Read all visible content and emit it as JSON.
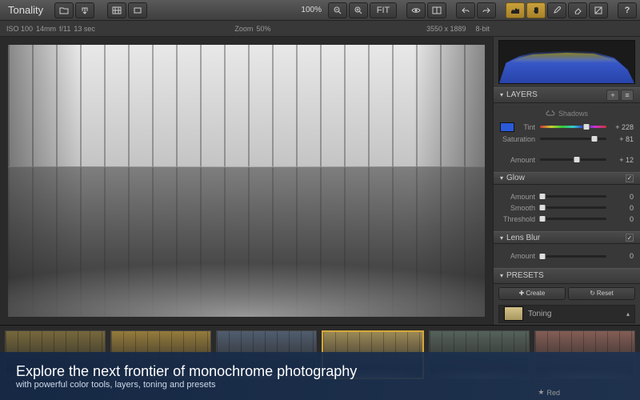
{
  "app": {
    "name": "Tonality"
  },
  "toolbar": {
    "zoom_pct": "100%",
    "fit_label": "FIT"
  },
  "info": {
    "iso": "ISO 100",
    "focal": "14mm",
    "aperture": "f/11",
    "shutter": "13  sec",
    "zoom_label": "Zoom",
    "zoom_value": "50%",
    "dimensions": "3550 x 1889",
    "bitdepth": "8-bit"
  },
  "layers": {
    "title": "LAYERS",
    "shadows_label": "Shadows",
    "tint_label": "Tint",
    "tint_value": "+ 228",
    "sat_label": "Saturation",
    "sat_value": "+ 81",
    "amount_label": "Amount",
    "amount_value": "+ 12",
    "tint_color": "#2a5ad8"
  },
  "glow": {
    "title": "Glow",
    "amount_label": "Amount",
    "amount_value": "0",
    "smooth_label": "Smooth",
    "smooth_value": "0",
    "threshold_label": "Threshold",
    "threshold_value": "0"
  },
  "lensblur": {
    "title": "Lens Blur",
    "amount_label": "Amount",
    "amount_value": "0"
  },
  "presets": {
    "title": "PRESETS",
    "create_label": "Create",
    "reset_label": "Reset",
    "category": "Toning"
  },
  "thumbs": {
    "colors": [
      "#8a7840",
      "#b09040",
      "#5a6a80",
      "#b8a060",
      "#607068",
      "#9a6a60"
    ],
    "selected_index": 3,
    "bottom_label": "Red"
  },
  "banner": {
    "title": "Explore the next frontier of monochrome photography",
    "subtitle": "with powerful color tools, layers, toning and presets"
  }
}
